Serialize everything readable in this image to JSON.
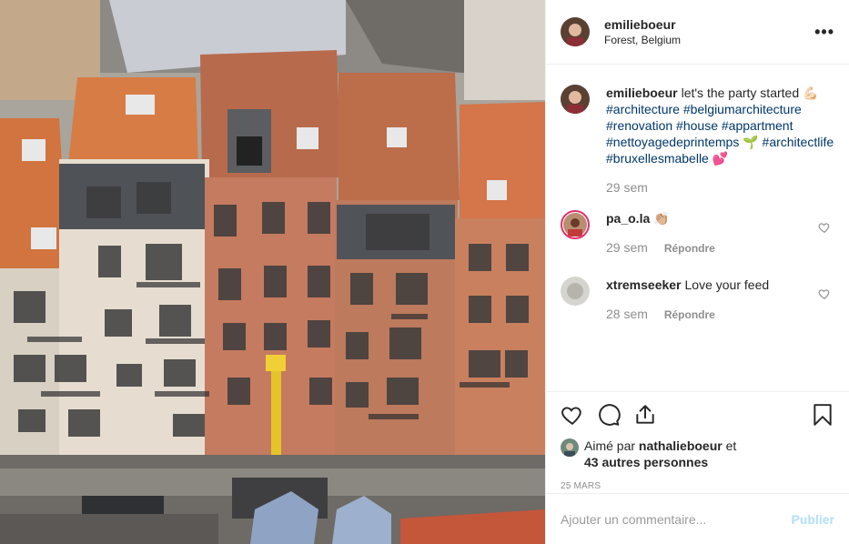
{
  "post": {
    "author": "emilieboeur",
    "location": "Forest, Belgium",
    "more_label": "•••"
  },
  "caption": {
    "user": "emilieboeur",
    "text": "let's the party started 💪🏻",
    "hashtags": "#architecture #belgiumarchitecture #renovation #house #appartment #nettoyagedeprintemps 🌱 #architectlife #bruxellesmabelle 💕",
    "time": "29 sem"
  },
  "comments": [
    {
      "user": "pa_o.la",
      "text": "👏🏼",
      "time": "29 sem",
      "reply": "Répondre"
    },
    {
      "user": "xtremseeker",
      "text": "Love your feed",
      "time": "28 sem",
      "reply": "Répondre"
    }
  ],
  "likes": {
    "prefix": "Aimé par",
    "user": "nathalieboeur",
    "suffix": "et",
    "others": "43 autres personnes"
  },
  "date": "25 MARS",
  "add_comment": {
    "placeholder": "Ajouter un commentaire...",
    "post_label": "Publier"
  },
  "icons": [
    "heart-icon",
    "comment-icon",
    "share-icon",
    "bookmark-icon"
  ],
  "colors": {
    "hashtag": "#00376b",
    "post_button": "#b2dffc",
    "muted": "#8e8e8e"
  }
}
